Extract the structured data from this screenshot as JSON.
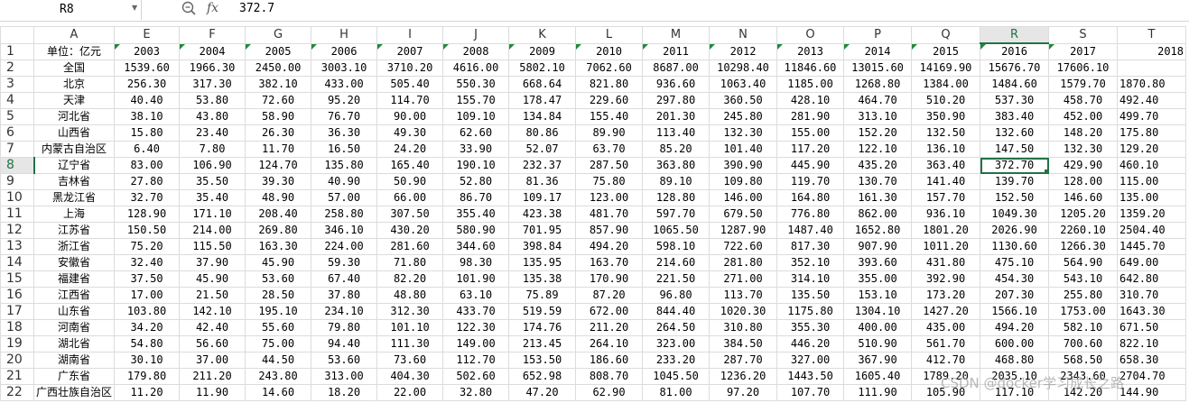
{
  "name_box": {
    "value": "R8"
  },
  "formula": {
    "value": "372.7"
  },
  "columns": [
    "A",
    "E",
    "F",
    "G",
    "H",
    "I",
    "J",
    "K",
    "L",
    "M",
    "N",
    "O",
    "P",
    "Q",
    "R",
    "S",
    "T"
  ],
  "row_numbers": [
    "1",
    "2",
    "3",
    "4",
    "5",
    "6",
    "7",
    "8",
    "9",
    "10",
    "11",
    "12",
    "13",
    "14",
    "15",
    "16",
    "17",
    "18",
    "19",
    "20",
    "21",
    "22"
  ],
  "rows": [
    [
      "单位：亿元",
      "2003",
      "2004",
      "2005",
      "2006",
      "2007",
      "2008",
      "2009",
      "2010",
      "2011",
      "2012",
      "2013",
      "2014",
      "2015",
      "2016",
      "2017",
      "2018"
    ],
    [
      "全国",
      "1539.60",
      "1966.30",
      "2450.00",
      "3003.10",
      "3710.20",
      "4616.00",
      "5802.10",
      "7062.60",
      "8687.00",
      "10298.40",
      "11846.60",
      "13015.60",
      "14169.90",
      "15676.70",
      "17606.10",
      ""
    ],
    [
      "北京",
      "256.30",
      "317.30",
      "382.10",
      "433.00",
      "505.40",
      "550.30",
      "668.64",
      "821.80",
      "936.60",
      "1063.40",
      "1185.00",
      "1268.80",
      "1384.00",
      "1484.60",
      "1579.70",
      "1870.80"
    ],
    [
      "天津",
      "40.40",
      "53.80",
      "72.60",
      "95.20",
      "114.70",
      "155.70",
      "178.47",
      "229.60",
      "297.80",
      "360.50",
      "428.10",
      "464.70",
      "510.20",
      "537.30",
      "458.70",
      "492.40"
    ],
    [
      "河北省",
      "38.10",
      "43.80",
      "58.90",
      "76.70",
      "90.00",
      "109.10",
      "134.84",
      "155.40",
      "201.30",
      "245.80",
      "281.90",
      "313.10",
      "350.90",
      "383.40",
      "452.00",
      "499.70"
    ],
    [
      "山西省",
      "15.80",
      "23.40",
      "26.30",
      "36.30",
      "49.30",
      "62.60",
      "80.86",
      "89.90",
      "113.40",
      "132.30",
      "155.00",
      "152.20",
      "132.50",
      "132.60",
      "148.20",
      "175.80"
    ],
    [
      "内蒙古自治区",
      "6.40",
      "7.80",
      "11.70",
      "16.50",
      "24.20",
      "33.90",
      "52.07",
      "63.70",
      "85.20",
      "101.40",
      "117.20",
      "122.10",
      "136.10",
      "147.50",
      "132.30",
      "129.20"
    ],
    [
      "辽宁省",
      "83.00",
      "106.90",
      "124.70",
      "135.80",
      "165.40",
      "190.10",
      "232.37",
      "287.50",
      "363.80",
      "390.90",
      "445.90",
      "435.20",
      "363.40",
      "372.70",
      "429.90",
      "460.10"
    ],
    [
      "吉林省",
      "27.80",
      "35.50",
      "39.30",
      "40.90",
      "50.90",
      "52.80",
      "81.36",
      "75.80",
      "89.10",
      "109.80",
      "119.70",
      "130.70",
      "141.40",
      "139.70",
      "128.00",
      "115.00"
    ],
    [
      "黑龙江省",
      "32.70",
      "35.40",
      "48.90",
      "57.00",
      "66.00",
      "86.70",
      "109.17",
      "123.00",
      "128.80",
      "146.00",
      "164.80",
      "161.30",
      "157.70",
      "152.50",
      "146.60",
      "135.00"
    ],
    [
      "上海",
      "128.90",
      "171.10",
      "208.40",
      "258.80",
      "307.50",
      "355.40",
      "423.38",
      "481.70",
      "597.70",
      "679.50",
      "776.80",
      "862.00",
      "936.10",
      "1049.30",
      "1205.20",
      "1359.20"
    ],
    [
      "江苏省",
      "150.50",
      "214.00",
      "269.80",
      "346.10",
      "430.20",
      "580.90",
      "701.95",
      "857.90",
      "1065.50",
      "1287.90",
      "1487.40",
      "1652.80",
      "1801.20",
      "2026.90",
      "2260.10",
      "2504.40"
    ],
    [
      "浙江省",
      "75.20",
      "115.50",
      "163.30",
      "224.00",
      "281.60",
      "344.60",
      "398.84",
      "494.20",
      "598.10",
      "722.60",
      "817.30",
      "907.90",
      "1011.20",
      "1130.60",
      "1266.30",
      "1445.70"
    ],
    [
      "安徽省",
      "32.40",
      "37.90",
      "45.90",
      "59.30",
      "71.80",
      "98.30",
      "135.95",
      "163.70",
      "214.60",
      "281.80",
      "352.10",
      "393.60",
      "431.80",
      "475.10",
      "564.90",
      "649.00"
    ],
    [
      "福建省",
      "37.50",
      "45.90",
      "53.60",
      "67.40",
      "82.20",
      "101.90",
      "135.38",
      "170.90",
      "221.50",
      "271.00",
      "314.10",
      "355.00",
      "392.90",
      "454.30",
      "543.10",
      "642.80"
    ],
    [
      "江西省",
      "17.00",
      "21.50",
      "28.50",
      "37.80",
      "48.80",
      "63.10",
      "75.89",
      "87.20",
      "96.80",
      "113.70",
      "135.50",
      "153.10",
      "173.20",
      "207.30",
      "255.80",
      "310.70"
    ],
    [
      "山东省",
      "103.80",
      "142.10",
      "195.10",
      "234.10",
      "312.30",
      "433.70",
      "519.59",
      "672.00",
      "844.40",
      "1020.30",
      "1175.80",
      "1304.10",
      "1427.20",
      "1566.10",
      "1753.00",
      "1643.30"
    ],
    [
      "河南省",
      "34.20",
      "42.40",
      "55.60",
      "79.80",
      "101.10",
      "122.30",
      "174.76",
      "211.20",
      "264.50",
      "310.80",
      "355.30",
      "400.00",
      "435.00",
      "494.20",
      "582.10",
      "671.50"
    ],
    [
      "湖北省",
      "54.80",
      "56.60",
      "75.00",
      "94.40",
      "111.30",
      "149.00",
      "213.45",
      "264.10",
      "323.00",
      "384.50",
      "446.20",
      "510.90",
      "561.70",
      "600.00",
      "700.60",
      "822.10"
    ],
    [
      "湖南省",
      "30.10",
      "37.00",
      "44.50",
      "53.60",
      "73.60",
      "112.70",
      "153.50",
      "186.60",
      "233.20",
      "287.70",
      "327.00",
      "367.90",
      "412.70",
      "468.80",
      "568.50",
      "658.30"
    ],
    [
      "广东省",
      "179.80",
      "211.20",
      "243.80",
      "313.00",
      "404.30",
      "502.60",
      "652.98",
      "808.70",
      "1045.50",
      "1236.20",
      "1443.50",
      "1605.40",
      "1789.20",
      "2035.10",
      "2343.60",
      "2704.70"
    ],
    [
      "广西壮族自治区",
      "11.20",
      "11.90",
      "14.60",
      "18.20",
      "22.00",
      "32.80",
      "47.20",
      "62.90",
      "81.00",
      "97.20",
      "107.70",
      "111.90",
      "105.90",
      "117.10",
      "142.20",
      "144.90"
    ]
  ],
  "watermark": "CSDN @docker学习成长之路"
}
